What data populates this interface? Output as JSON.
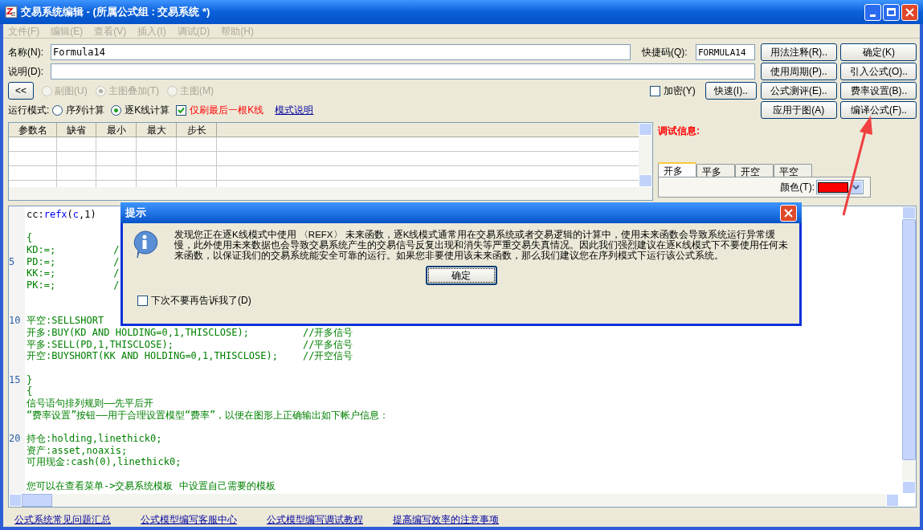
{
  "window": {
    "title": "交易系统编辑 - (所属公式组 : 交易系统 *)"
  },
  "menu": [
    {
      "label": "文件(F)",
      "disabled": true
    },
    {
      "label": "编辑(E)",
      "disabled": true
    },
    {
      "label": "查看(V)",
      "disabled": true
    },
    {
      "label": "插入(I)",
      "disabled": true
    },
    {
      "label": "调试(D)",
      "disabled": true
    },
    {
      "label": "帮助(H)",
      "disabled": true
    }
  ],
  "name_field": {
    "label": "名称(N):",
    "value": "Formula14"
  },
  "shortcut_field": {
    "label": "快捷码(Q):",
    "value": "FORMULA14"
  },
  "desc_field": {
    "label": "说明(D):"
  },
  "collapse_button": "<<",
  "chart_type": [
    {
      "label": "副图(U)",
      "selected": false,
      "disabled": true
    },
    {
      "label": "主图叠加(T)",
      "selected": true,
      "disabled": true
    },
    {
      "label": "主图(M)",
      "selected": false,
      "disabled": true
    }
  ],
  "encrypt": {
    "label": "加密(Y)",
    "checked": false
  },
  "quick_button": "快速(I)..",
  "run_mode": {
    "label": "运行模式:",
    "options": [
      {
        "label": "序列计算",
        "selected": false
      },
      {
        "label": "逐K线计算",
        "selected": true
      }
    ],
    "refresh_last": {
      "label": "仅刷最后一根K线",
      "checked": true
    },
    "link": "模式说明"
  },
  "buttons": [
    {
      "label": "用法注释(R).."
    },
    {
      "label": "确定(K)"
    },
    {
      "label": "使用周期(P).."
    },
    {
      "label": "引入公式(O).."
    },
    {
      "label": "公式测评(E).."
    },
    {
      "label": "费率设置(B).."
    },
    {
      "label": "应用于图(A)"
    },
    {
      "label": "编译公式(F).."
    }
  ],
  "params_table": {
    "columns": [
      "参数名",
      "缺省",
      "最小",
      "最大",
      "步长"
    ]
  },
  "debug_label": "调试信息:",
  "signal_tabs": [
    {
      "label": "开多",
      "selected": true
    },
    {
      "label": "平多",
      "selected": false
    },
    {
      "label": "开空",
      "selected": false
    },
    {
      "label": "平空",
      "selected": false
    }
  ],
  "color_field": {
    "label": "颜色(T):",
    "color": "#ff0000"
  },
  "editor_lines": [
    {
      "parts": [
        {
          "kind": "code",
          "text": "cc:"
        },
        {
          "kind": "func",
          "text": "refx"
        },
        {
          "kind": "code",
          "text": "("
        },
        {
          "kind": "func",
          "text": "c"
        },
        {
          "kind": "code",
          "text": ",1)"
        }
      ]
    },
    {
      "kind": "after_blank",
      "parts": [
        {
          "kind": "green",
          "text": "{"
        }
      ]
    },
    {
      "parts": [
        {
          "kind": "green",
          "text": "KD:=;          /"
        }
      ]
    },
    {
      "number": "5",
      "parts": [
        {
          "kind": "green",
          "text": "PD:=;          /"
        }
      ]
    },
    {
      "parts": [
        {
          "kind": "green",
          "text": "KK:=;          /"
        }
      ]
    },
    {
      "parts": [
        {
          "kind": "green",
          "text": "PK:=;          /"
        }
      ]
    },
    {
      "kind": "after_two_blanks",
      "number": "10",
      "parts": [
        {
          "kind": "green",
          "text": "平空:SELLSHORT"
        }
      ]
    },
    {
      "parts": [
        {
          "kind": "green",
          "text": "开多:BUY(KD AND HOLDING=0,1,THISCLOSE);"
        }
      ],
      "comment": "//开多信号"
    },
    {
      "parts": [
        {
          "kind": "green",
          "text": "平多:SELL(PD,1,THISCLOSE);"
        }
      ],
      "comment": "//平多信号"
    },
    {
      "parts": [
        {
          "kind": "green",
          "text": "开空:BUYSHORT(KK AND HOLDING=0,1,THISCLOSE);"
        }
      ],
      "comment": "//开空信号"
    },
    {
      "kind": "after_blank",
      "number": "15",
      "parts": [
        {
          "kind": "green",
          "text": "}"
        }
      ]
    },
    {
      "parts": [
        {
          "kind": "green",
          "text": "{"
        }
      ]
    },
    {
      "parts": [
        {
          "kind": "green",
          "text": "信号语句排列规则——先平后开"
        }
      ]
    },
    {
      "parts": [
        {
          "kind": "green",
          "text": "“费率设置”按钮——用于合理设置模型“费率”，以便在图形上正确输出如下帐户信息："
        }
      ]
    },
    {
      "kind": "after_blank",
      "number": "20",
      "parts": [
        {
          "kind": "green",
          "text": "持仓:holding,linethick0;"
        }
      ]
    },
    {
      "parts": [
        {
          "kind": "green",
          "text": "资产:asset,noaxis;"
        }
      ]
    },
    {
      "parts": [
        {
          "kind": "green",
          "text": "可用现金:cash(0),linethick0;"
        }
      ]
    },
    {
      "kind": "after_blank",
      "parts": [
        {
          "kind": "green",
          "text": "您可以在查看菜单->交易系统模板 中设置自己需要的模板"
        }
      ]
    }
  ],
  "help_links": [
    "公式系统常见问题汇总",
    "公式模型编写客服中心",
    "公式模型编写调试教程",
    "提高编写效率的注意事项"
  ],
  "dialog": {
    "title": "提示",
    "message": "发现您正在逐K线模式中使用 〈REFX〉 未来函数，逐K线模式通常用在交易系统或者交易逻辑的计算中，使用未来函数会导致系统运行异常缓慢，此外使用未来数据也会导致交易系统产生的交易信号反复出现和消失等严重交易失真情况。因此我们强烈建议在逐K线模式下不要使用任何未来函数，以保证我们的交易系统能安全可靠的运行。如果您非要使用该未来函数，那么我们建议您在序列模式下运行该公式系统。",
    "ok": "确定",
    "dont_show": {
      "label": "下次不要再告诉我了(D)",
      "checked": false
    }
  }
}
